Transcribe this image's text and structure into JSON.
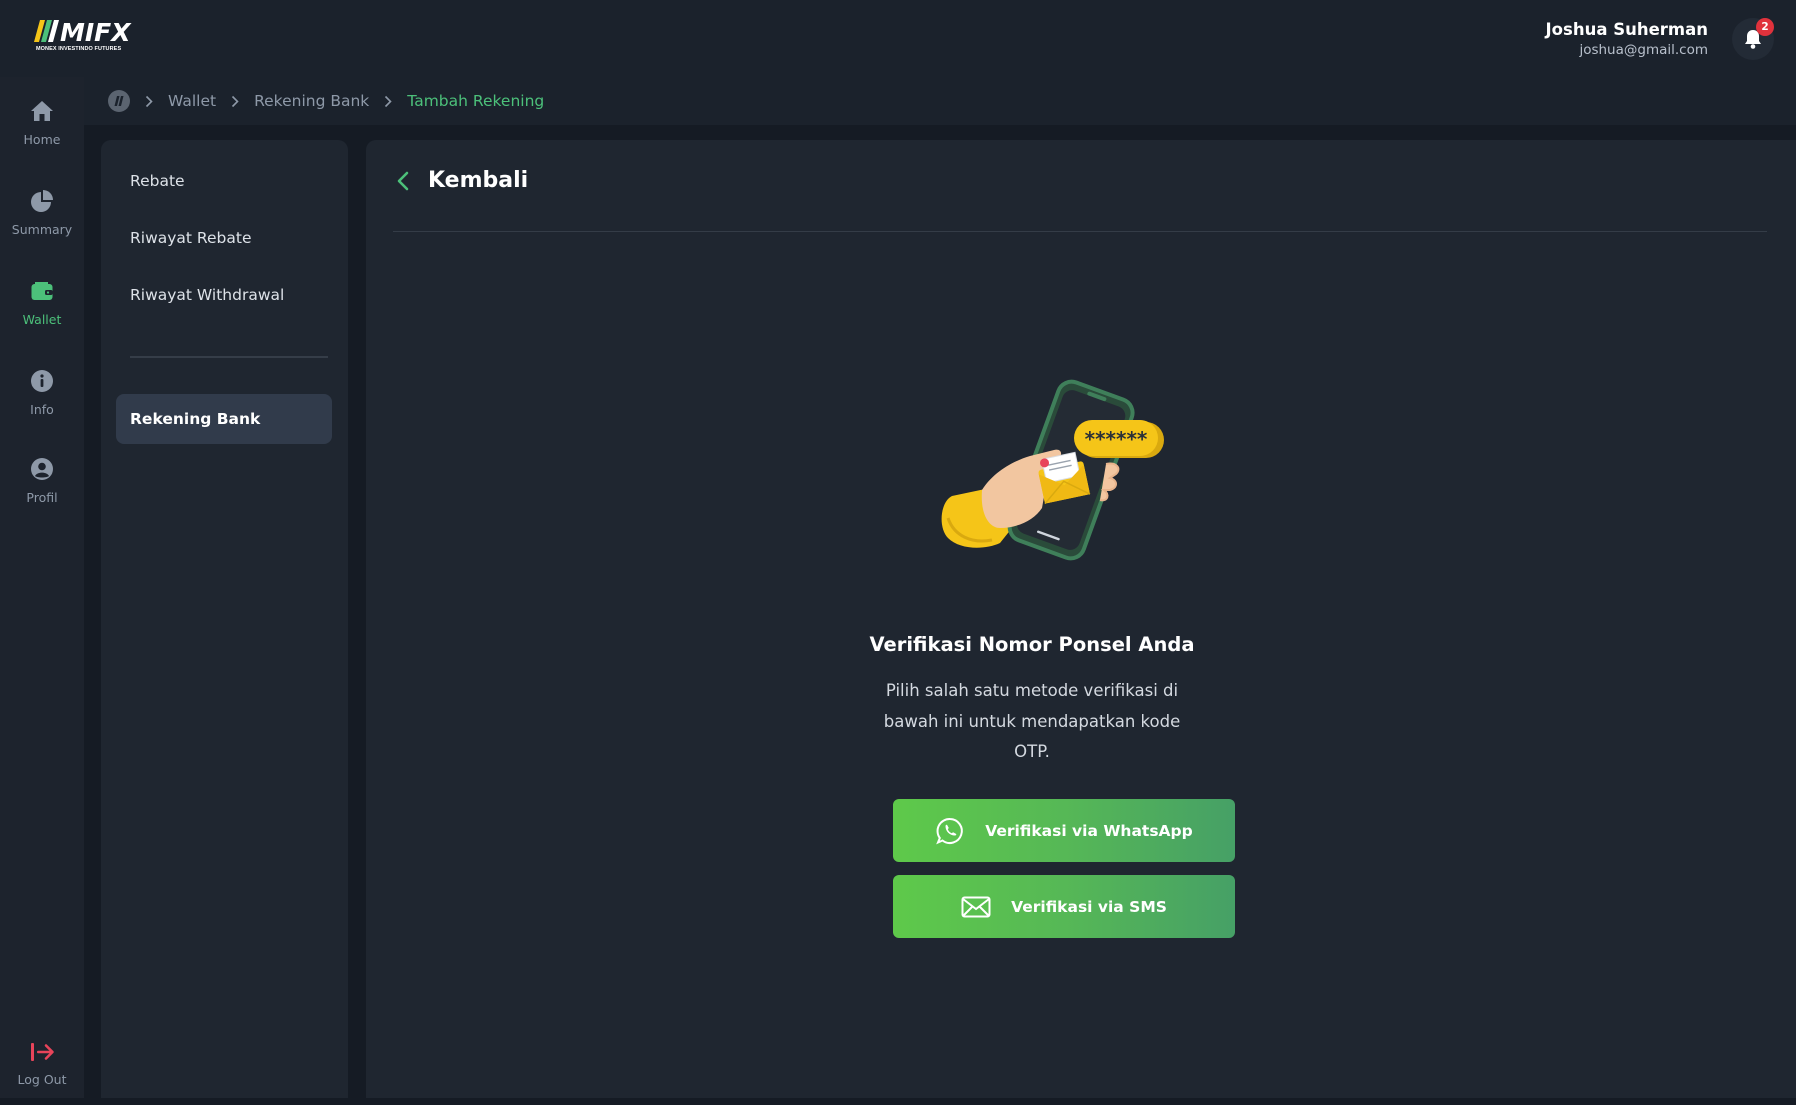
{
  "brand": {
    "logo_text": "MIFX",
    "logo_subtitle": "MONEX INVESTINDO FUTURES"
  },
  "user": {
    "name": "Joshua Suherman",
    "email": "joshua@gmail.com",
    "notification_count": "2"
  },
  "nav": {
    "items": [
      {
        "label": "Home",
        "icon": "home-icon"
      },
      {
        "label": "Summary",
        "icon": "pie-chart-icon"
      },
      {
        "label": "Wallet",
        "icon": "wallet-icon",
        "active": true
      },
      {
        "label": "Info",
        "icon": "info-icon"
      },
      {
        "label": "Profil",
        "icon": "user-icon"
      }
    ],
    "logout_label": "Log Out"
  },
  "breadcrumb": {
    "items": [
      "Wallet",
      "Rekening Bank",
      "Tambah Rekening"
    ]
  },
  "submenu": {
    "items": [
      "Rebate",
      "Riwayat Rebate",
      "Riwayat Withdrawal"
    ],
    "active_item": "Rekening Bank"
  },
  "main": {
    "back_label": "Kembali",
    "otp_mask": "******",
    "title": "Verifikasi Nomor Ponsel Anda",
    "description": "Pilih salah satu metode verifikasi di bawah ini untuk mendapatkan kode OTP.",
    "buttons": {
      "whatsapp": "Verifikasi via WhatsApp",
      "sms": "Verifikasi via SMS"
    }
  },
  "colors": {
    "accent_green": "#4cc07a",
    "logout_red": "#e8445a",
    "badge_red": "#e0323c",
    "panel_bg": "#1f2630"
  }
}
